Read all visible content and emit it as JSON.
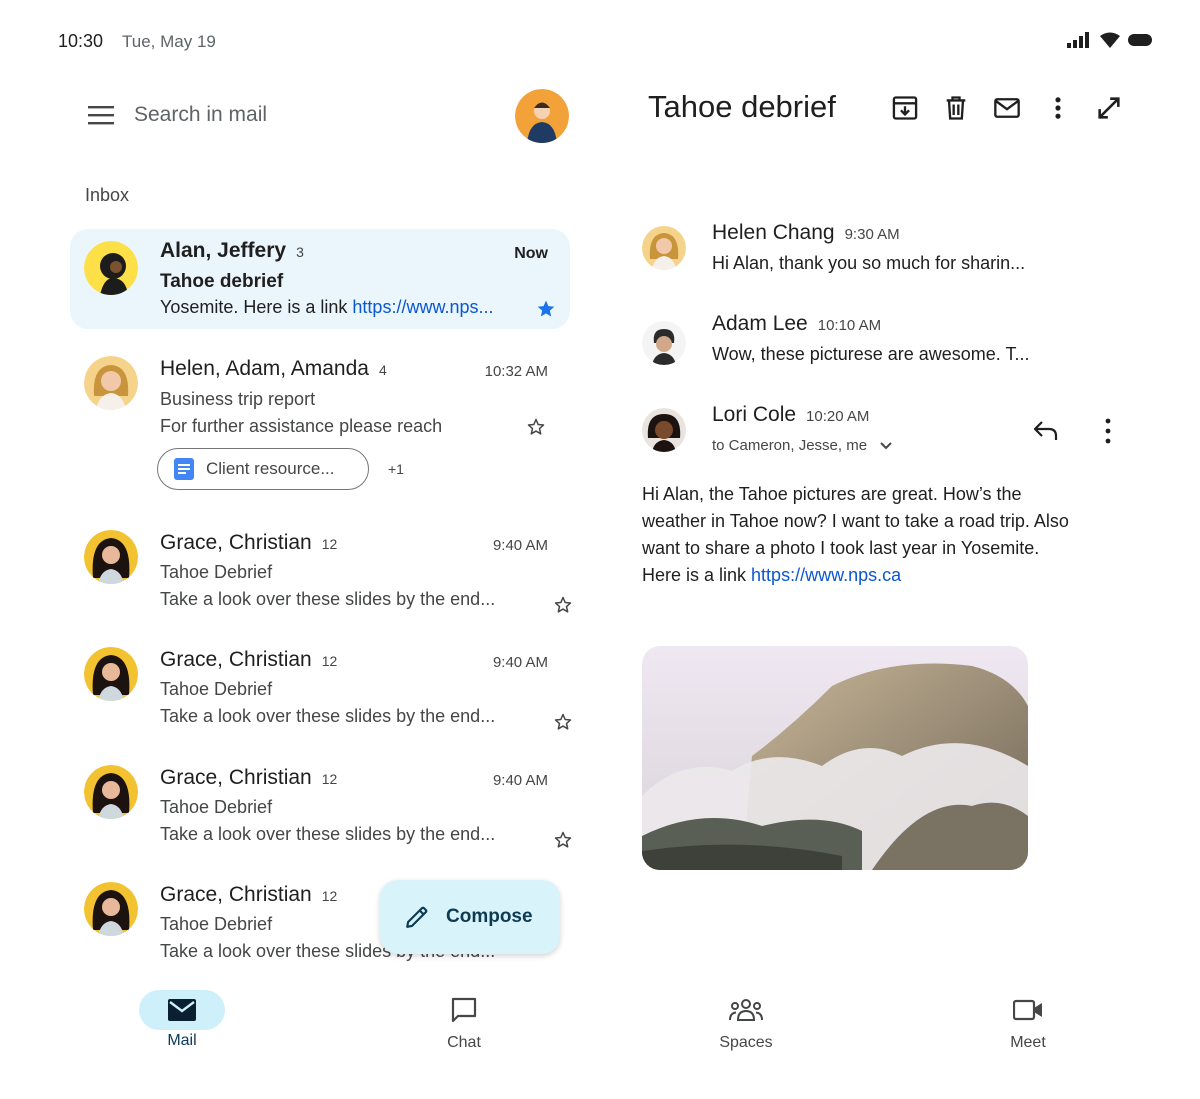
{
  "status": {
    "time": "10:30",
    "date": "Tue, May 19"
  },
  "search": {
    "placeholder": "Search in mail"
  },
  "inbox": {
    "label": "Inbox"
  },
  "emails": [
    {
      "sender": "Alan, Jeffery",
      "count": "3",
      "time": "Now",
      "subject": "Tahoe debrief",
      "snippet": "Yosemite. Here is a link ",
      "snippet_link": "https://www.nps...",
      "starred": true,
      "unread": true
    },
    {
      "sender": "Helen, Adam, Amanda",
      "count": "4",
      "time": "10:32 AM",
      "subject": "Business trip report",
      "snippet": "For further assistance please reach",
      "starred": false,
      "attachment": "Client resource...",
      "more": "+1"
    },
    {
      "sender": "Grace, Christian",
      "count": "12",
      "time": "9:40 AM",
      "subject": "Tahoe Debrief",
      "snippet": "Take a look over these slides by the end...",
      "starred": false
    },
    {
      "sender": "Grace, Christian",
      "count": "12",
      "time": "9:40 AM",
      "subject": "Tahoe Debrief",
      "snippet": "Take a look over these slides by the end...",
      "starred": false
    },
    {
      "sender": "Grace, Christian",
      "count": "12",
      "time": "9:40 AM",
      "subject": "Tahoe Debrief",
      "snippet": "Take a look over these slides by the end...",
      "starred": false
    },
    {
      "sender": "Grace, Christian",
      "count": "12",
      "time": "",
      "subject": "Tahoe Debrief",
      "snippet": "Take a look over these slides by the end...",
      "starred": false
    }
  ],
  "compose": {
    "label": "Compose"
  },
  "nav": [
    {
      "label": "Mail",
      "icon": "mail-icon",
      "active": true
    },
    {
      "label": "Chat",
      "icon": "chat-icon",
      "active": false
    },
    {
      "label": "Spaces",
      "icon": "spaces-icon",
      "active": false
    },
    {
      "label": "Meet",
      "icon": "meet-icon",
      "active": false
    }
  ],
  "thread": {
    "title": "Tahoe debrief",
    "toolbar": [
      "archive-icon",
      "delete-icon",
      "mark-unread-icon",
      "more-vert-icon",
      "expand-icon"
    ],
    "messages": [
      {
        "sender": "Helen Chang",
        "time": "9:30 AM",
        "snippet": "Hi Alan, thank you so much for sharin..."
      },
      {
        "sender": "Adam Lee",
        "time": "10:10 AM",
        "snippet": "Wow, these picturese are awesome. T..."
      },
      {
        "sender": "Lori Cole",
        "time": "10:20 AM",
        "recipients": "to Cameron, Jesse, me",
        "body": "Hi Alan, the Tahoe pictures are great. How’s the weather in Tahoe now? I want to take a road trip. Also want to share a photo I took last year in Yosemite. Here is a link ",
        "body_link": "https://www.nps.ca"
      }
    ]
  },
  "colors": {
    "selected_row": "#eaf6fc",
    "accent": "#0b57d0",
    "compose_bg": "#d9f3fb",
    "nav_active": "#cdf0fa"
  }
}
